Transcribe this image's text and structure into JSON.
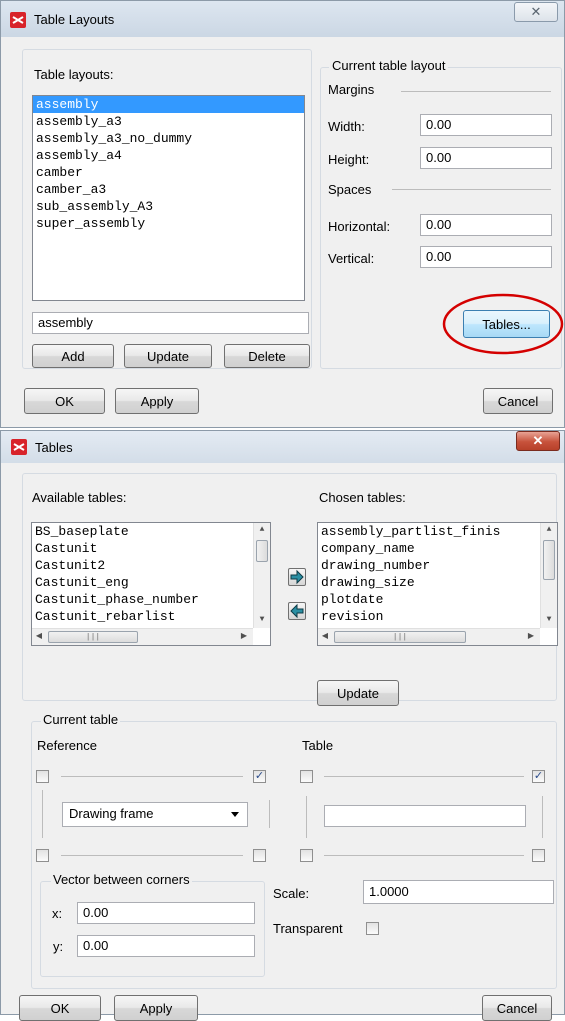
{
  "layouts_dialog": {
    "title": "Table Layouts",
    "close_glyph": "✕",
    "list_label": "Table layouts:",
    "layouts": [
      "assembly",
      "assembly_a3",
      "assembly_a3_no_dummy",
      "assembly_a4",
      "camber",
      "camber_a3",
      "sub_assembly_A3",
      "super_assembly"
    ],
    "selected_index": 0,
    "name_value": "assembly",
    "add_label": "Add",
    "update_label": "Update",
    "delete_label": "Delete",
    "current_title": "Current table layout",
    "margins_label": "Margins",
    "width_label": "Width:",
    "width_value": "0.00",
    "height_label": "Height:",
    "height_value": "0.00",
    "spaces_label": "Spaces",
    "horizontal_label": "Horizontal:",
    "horizontal_value": "0.00",
    "vertical_label": "Vertical:",
    "vertical_value": "0.00",
    "tables_button_label": "Tables...",
    "ok_label": "OK",
    "apply_label": "Apply",
    "cancel_label": "Cancel",
    "highlight_color": "#d40000"
  },
  "tables_dialog": {
    "title": "Tables",
    "close_glyph": "✕",
    "available_label": "Available tables:",
    "available_tables": [
      "BS_baseplate",
      "Castunit",
      "Castunit2",
      "Castunit_eng",
      "Castunit_phase_number",
      "Castunit_rebarlist"
    ],
    "chosen_label": "Chosen tables:",
    "chosen_tables": [
      "assembly_partlist_finis",
      "company_name",
      "drawing_number",
      "drawing_size",
      "plotdate",
      "revision"
    ],
    "move_right_icon": "arrow-right-icon",
    "move_left_icon": "arrow-left-icon",
    "update_label": "Update",
    "current_table_title": "Current table",
    "reference_label": "Reference",
    "table_label": "Table",
    "reference_combo_value": "Drawing frame",
    "table_field_value": "",
    "reference_corners": {
      "top_left": false,
      "top_right": true,
      "bottom_left": false,
      "bottom_right": false
    },
    "table_corners": {
      "top_left": false,
      "top_right": true,
      "bottom_left": false,
      "bottom_right": false
    },
    "vector_title": "Vector between corners",
    "x_label": "x:",
    "x_value": "0.00",
    "y_label": "y:",
    "y_value": "0.00",
    "scale_label": "Scale:",
    "scale_value": "1.0000",
    "transparent_label": "Transparent",
    "transparent_checked": false,
    "ok_label": "OK",
    "apply_label": "Apply",
    "cancel_label": "Cancel"
  },
  "colors": {
    "selection": "#3399ff",
    "dialog_bg": "#f0f0f0",
    "arrow_teal": "#2a8fa3"
  }
}
